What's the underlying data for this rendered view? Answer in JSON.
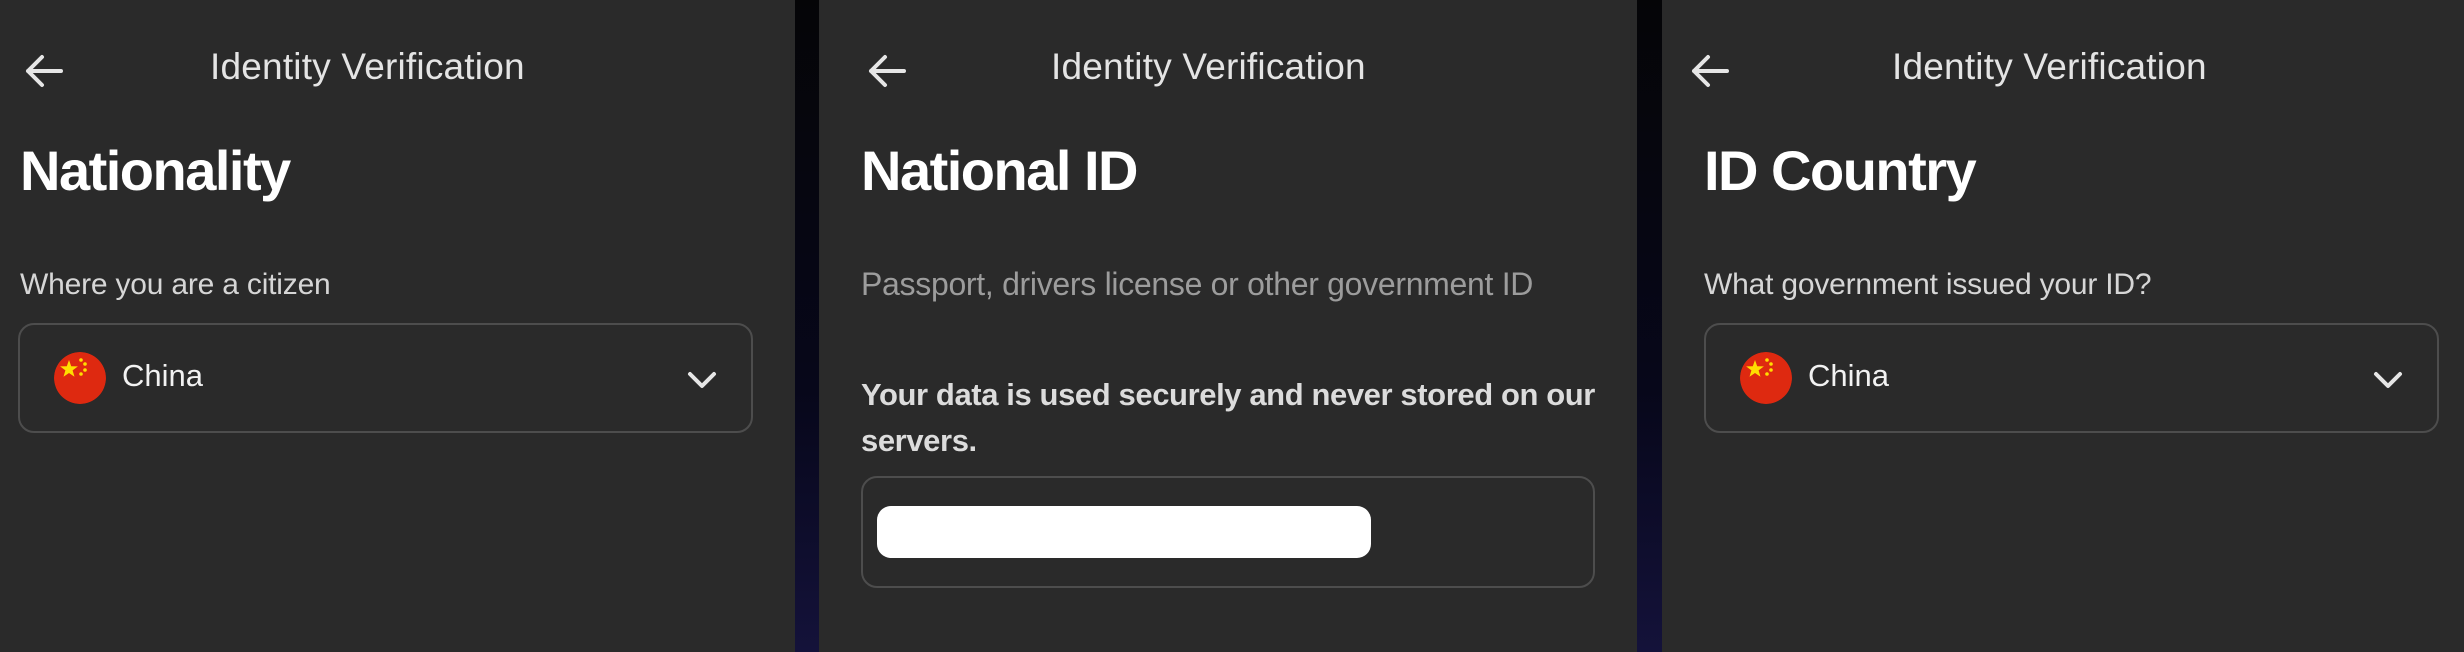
{
  "screens": [
    {
      "header": {
        "title": "Identity Verification",
        "back_icon": "arrow-left-icon"
      },
      "title": "Nationality",
      "field_label": "Where you are a citizen",
      "select": {
        "value": "China",
        "flag_icon": "china-flag-icon",
        "chevron_icon": "chevron-down-icon"
      }
    },
    {
      "header": {
        "title": "Identity Verification",
        "back_icon": "arrow-left-icon"
      },
      "title": "National ID",
      "subtitle": "Passport, drivers license or other government ID",
      "notice": "Your data is used securely and never stored on our servers.",
      "input": {
        "value": "",
        "redacted": true
      }
    },
    {
      "header": {
        "title": "Identity Verification",
        "back_icon": "arrow-left-icon"
      },
      "title": "ID Country",
      "field_label": "What government issued your ID?",
      "select": {
        "value": "China",
        "flag_icon": "china-flag-icon",
        "chevron_icon": "chevron-down-icon"
      }
    }
  ],
  "colors": {
    "panel_bg": "#2a2a2a",
    "border": "#4d4d4d",
    "flag_red": "#de2910",
    "flag_yellow": "#ffde00"
  }
}
